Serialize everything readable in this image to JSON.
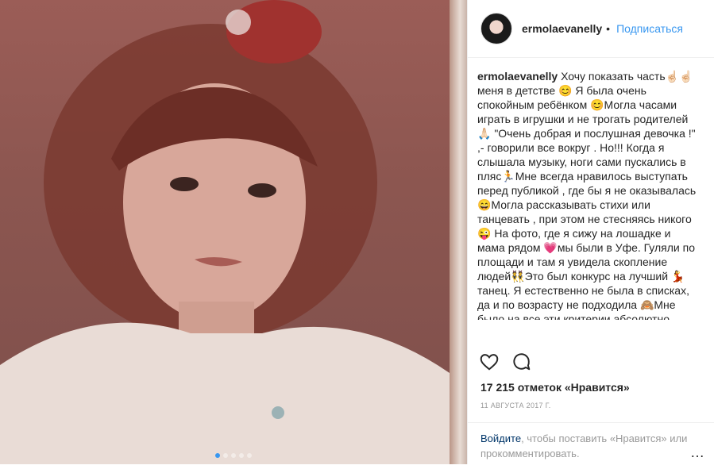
{
  "post": {
    "username": "ermolaevanelly",
    "separator": "•",
    "follow_label": "Подписаться",
    "caption_text": "Хочу показать часть☝🏻☝🏻меня в детстве 😊 Я была очень спокойным ребёнком 😊Могла часами играть в игрушки и не трогать родителей 🙏🏻 \"Очень добрая и послушная девочка !\" ,- говорили все вокруг . Но!!! Когда я слышала музыку, ноги сами пускались в пляс🏃Мне всегда нравилось выступать перед публикой , где бы я не оказывалась 😄Могла рассказывать стихи или танцевать , при этом не стесняясь никого 😜 На фото, где я сижу на лошадке и мама рядом 💗мы были в Уфе. Гуляли по площади и там я увидела скопление людей👯Это был конкурс на лучший 💃танец. Я естественно не была в списках, да и по возрасту не подходила 🙈Мне было на все эти критерии абсолютно плевать😄 По среди какого то номера , я 💃",
    "likes": "17 215 отметок «Нравится»",
    "date": "11 августа 2017 г.",
    "login_link": "Войдите",
    "login_text": ", чтобы поставить «Нравится» или прокомментировать.",
    "more": "…"
  },
  "carousel": {
    "count": 5,
    "active_index": 0
  },
  "icons": {
    "like": "heart-icon",
    "comment": "comment-icon"
  },
  "colors": {
    "accent": "#3897f0",
    "link": "#003569",
    "muted": "#999999",
    "text": "#262626"
  }
}
